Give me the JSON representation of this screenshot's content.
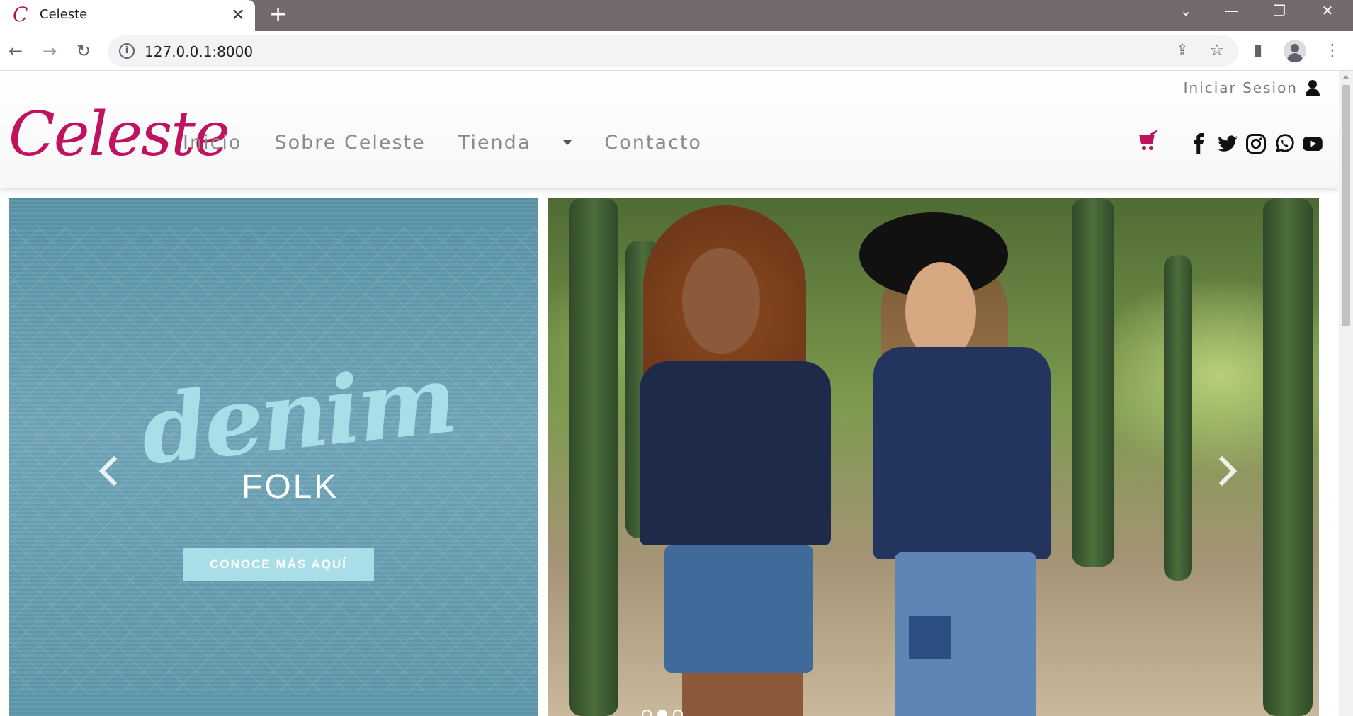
{
  "browser": {
    "tab_title": "Celeste",
    "tab_favicon": "C",
    "tab_close": "✕",
    "new_tab": "+",
    "url": "127.0.0.1:8000",
    "window_controls": {
      "dropdown": "⌄",
      "minimize": "—",
      "restore": "❐",
      "close": "✕"
    },
    "nav": {
      "back": "←",
      "forward": "→",
      "reload": "↻"
    },
    "info_icon": "i",
    "toolbar_icons": {
      "share": "⇪",
      "bookmark": "☆",
      "sidepanel": "▮",
      "menu": "⋮"
    }
  },
  "site": {
    "login_label": "Iniciar Sesion",
    "logo": "Celeste",
    "menu": {
      "inicio": "Inicio",
      "sobre": "Sobre Celeste",
      "tienda": "Tienda",
      "contacto": "Contacto"
    },
    "accent_color": "#c0125f",
    "social_icons": [
      "facebook-icon",
      "twitter-icon",
      "instagram-icon",
      "whatsapp-icon",
      "youtube-icon"
    ]
  },
  "carousel": {
    "promo_script": "denim",
    "promo_title": "FOLK",
    "cta_label": "CONOCE MÁS AQUÍ",
    "slide_count": 3,
    "active_slide": 2
  }
}
